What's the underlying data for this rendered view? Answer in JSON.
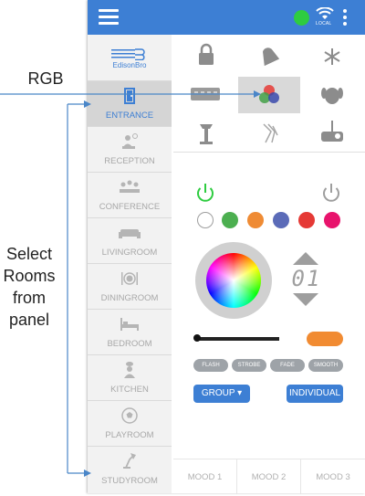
{
  "annotations": {
    "rgb_label": "RGB",
    "select_lines": [
      "Select",
      "Rooms",
      "from",
      "panel"
    ]
  },
  "topbar": {
    "wifi_label": "LOCAL",
    "status_color": "#2ecc40",
    "accent": "#3d7fd4"
  },
  "sidebar": {
    "logo_text": "EdisonBro",
    "rooms": [
      {
        "label": "ENTRANCE",
        "icon": "door-icon",
        "active": true
      },
      {
        "label": "RECEPTION",
        "icon": "receptionist-icon"
      },
      {
        "label": "CONFERENCE",
        "icon": "conference-icon"
      },
      {
        "label": "LIVINGROOM",
        "icon": "sofa-icon"
      },
      {
        "label": "DININGROOM",
        "icon": "dining-icon"
      },
      {
        "label": "BEDROOM",
        "icon": "bed-icon"
      },
      {
        "label": "KITCHEN",
        "icon": "chef-icon"
      },
      {
        "label": "PLAYROOM",
        "icon": "soccer-ball-icon"
      },
      {
        "label": "STUDYROOM",
        "icon": "desk-lamp-icon"
      }
    ]
  },
  "devices": [
    "lock-icon",
    "bell-icon",
    "ac-snowflake-icon",
    "hdmi-switch-icon",
    "rgb-icon",
    "pet-icon",
    "lamp-icon",
    "curtain-icon",
    "projector-icon"
  ],
  "rgb_panel": {
    "swatches": [
      "#ffffff",
      "#4caf50",
      "#ef8b34",
      "#5b6bb8",
      "#e53935",
      "#e8136c"
    ],
    "segment_display": "01",
    "slider_level": 0.03,
    "toggle_color": "#f18b32",
    "modes": [
      "FLASH",
      "STROBE",
      "FADE",
      "SMOOTH"
    ],
    "group_label": "GROUP",
    "individual_label": "INDIVIDUAL"
  },
  "moods": [
    "MOOD 1",
    "MOOD 2",
    "MOOD 3"
  ]
}
